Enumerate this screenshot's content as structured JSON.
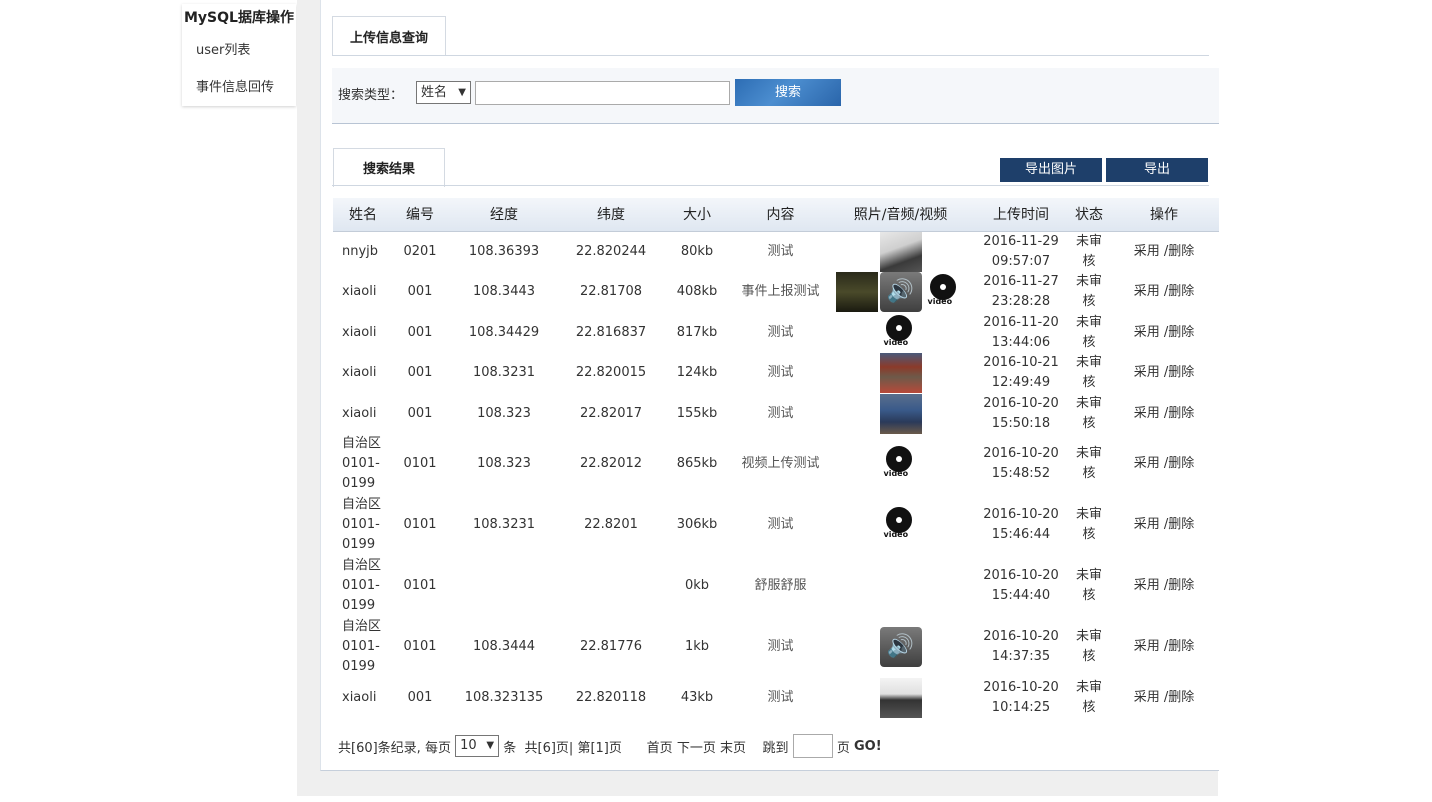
{
  "sidebar": {
    "title": "MySQL据库操作",
    "items": [
      {
        "label": "user列表"
      },
      {
        "label": "事件信息回传"
      }
    ]
  },
  "upload_tab": {
    "label": "上传信息查询"
  },
  "search": {
    "label": "搜索类型：",
    "type_selected": "姓名",
    "input_value": "",
    "button_label": "搜索"
  },
  "results_tab": {
    "label": "搜索结果"
  },
  "actions": {
    "export_images": "导出图片",
    "export": "导出"
  },
  "table": {
    "headers": [
      "姓名",
      "编号",
      "经度",
      "纬度",
      "大小",
      "内容",
      "照片/音频/视频",
      "上传时间",
      "状态",
      "操作"
    ],
    "rows": [
      {
        "name": [
          "nnyjb"
        ],
        "id": "0201",
        "lng": "108.36393",
        "lat": "22.820244",
        "size": "80kb",
        "content": "测试",
        "media": [
          "photo-a"
        ],
        "date": "2016-11-29",
        "time": "09:57:07",
        "status": [
          "未审",
          "核"
        ],
        "adopt": "采用",
        "del": "/删除"
      },
      {
        "name": [
          "xiaoli"
        ],
        "id": "001",
        "lng": "108.3443",
        "lat": "22.81708",
        "size": "408kb",
        "content": "事件上报测试",
        "media": [
          "photo-e",
          "audio",
          "video"
        ],
        "date": "2016-11-27",
        "time": "23:28:28",
        "status": [
          "未审",
          "核"
        ],
        "adopt": "采用",
        "del": "/删除"
      },
      {
        "name": [
          "xiaoli"
        ],
        "id": "001",
        "lng": "108.34429",
        "lat": "22.816837",
        "size": "817kb",
        "content": "测试",
        "media": [
          "video"
        ],
        "date": "2016-11-20",
        "time": "13:44:06",
        "status": [
          "未审",
          "核"
        ],
        "adopt": "采用",
        "del": "/删除"
      },
      {
        "name": [
          "xiaoli"
        ],
        "id": "001",
        "lng": "108.3231",
        "lat": "22.820015",
        "size": "124kb",
        "content": "测试",
        "media": [
          "photo-b"
        ],
        "date": "2016-10-21",
        "time": "12:49:49",
        "status": [
          "未审",
          "核"
        ],
        "adopt": "采用",
        "del": "/删除"
      },
      {
        "name": [
          "xiaoli"
        ],
        "id": "001",
        "lng": "108.323",
        "lat": "22.82017",
        "size": "155kb",
        "content": "测试",
        "media": [
          "photo-c"
        ],
        "date": "2016-10-20",
        "time": "15:50:18",
        "status": [
          "未审",
          "核"
        ],
        "adopt": "采用",
        "del": "/删除"
      },
      {
        "name": [
          "自治区",
          "0101-",
          "0199"
        ],
        "id": "0101",
        "lng": "108.323",
        "lat": "22.82012",
        "size": "865kb",
        "content": "视频上传测试",
        "media": [
          "video"
        ],
        "date": "2016-10-20",
        "time": "15:48:52",
        "status": [
          "未审",
          "核"
        ],
        "adopt": "采用",
        "del": "/删除"
      },
      {
        "name": [
          "自治区",
          "0101-",
          "0199"
        ],
        "id": "0101",
        "lng": "108.3231",
        "lat": "22.8201",
        "size": "306kb",
        "content": "测试",
        "media": [
          "video"
        ],
        "date": "2016-10-20",
        "time": "15:46:44",
        "status": [
          "未审",
          "核"
        ],
        "adopt": "采用",
        "del": "/删除"
      },
      {
        "name": [
          "自治区",
          "0101-",
          "0199"
        ],
        "id": "0101",
        "lng": "",
        "lat": "",
        "size": "0kb",
        "content": "舒服舒服",
        "media": [],
        "date": "2016-10-20",
        "time": "15:44:40",
        "status": [
          "未审",
          "核"
        ],
        "adopt": "采用",
        "del": "/删除"
      },
      {
        "name": [
          "自治区",
          "0101-",
          "0199"
        ],
        "id": "0101",
        "lng": "108.3444",
        "lat": "22.81776",
        "size": "1kb",
        "content": "测试",
        "media": [
          "audio"
        ],
        "date": "2016-10-20",
        "time": "14:37:35",
        "status": [
          "未审",
          "核"
        ],
        "adopt": "采用",
        "del": "/删除"
      },
      {
        "name": [
          "xiaoli"
        ],
        "id": "001",
        "lng": "108.323135",
        "lat": "22.820118",
        "size": "43kb",
        "content": "测试",
        "media": [
          "photo-d"
        ],
        "date": "2016-10-20",
        "time": "10:14:25",
        "status": [
          "未审",
          "核"
        ],
        "adopt": "采用",
        "del": "/删除"
      }
    ]
  },
  "pager": {
    "total_text": "共[60]条纪录, 每页",
    "per_page": "10",
    "unit": "条",
    "pages_text": "共[6]页| 第[1]页",
    "first": "首页",
    "next": "下一页",
    "last": "末页",
    "jump_label": "跳到",
    "jump_value": "",
    "page_unit": "页",
    "go": "GO!"
  },
  "icons": {
    "select_arrow": "▼",
    "audio_glyph": "🔊",
    "video_label": "video"
  },
  "colors": {
    "search_button": "#2d6db4",
    "dark_button": "#1e3f6a",
    "header_gradient_bottom": "#dfe7f1"
  }
}
